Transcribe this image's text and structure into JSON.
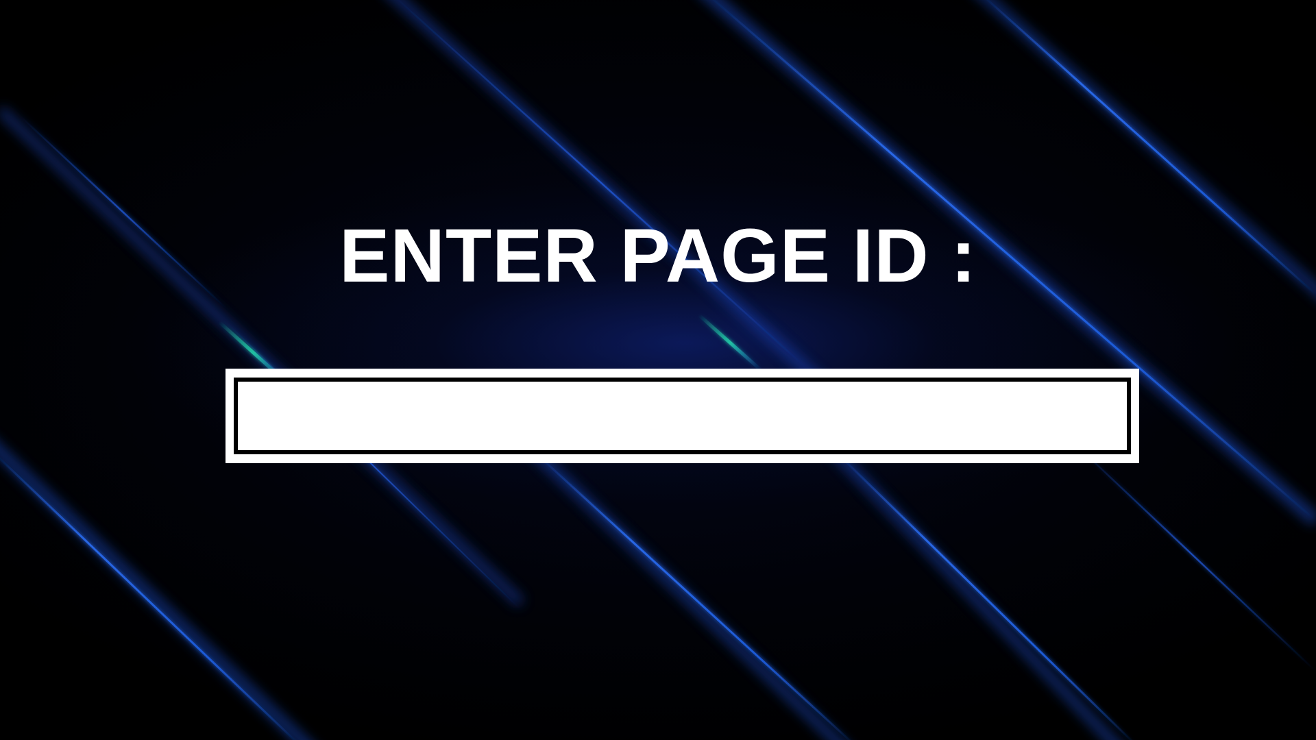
{
  "prompt": {
    "label": "ENTER PAGE ID :"
  },
  "page_id_input": {
    "value": "",
    "placeholder": ""
  },
  "colors": {
    "background": "#000000",
    "glow": "#0b1e86",
    "streak_blue": "#1f5fe0",
    "streak_teal": "#1ab09a",
    "text": "#ffffff",
    "input_fill": "#ffffff",
    "input_border": "#000000"
  }
}
